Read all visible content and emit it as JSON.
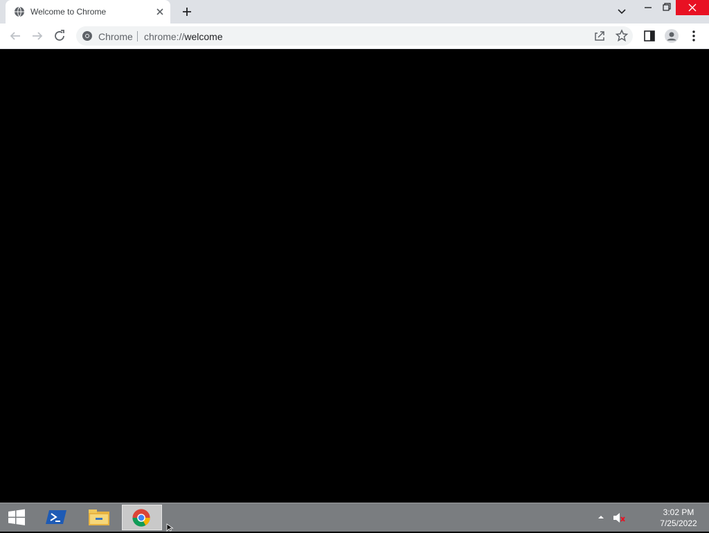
{
  "browser": {
    "tab": {
      "title": "Welcome to Chrome",
      "favicon": "globe-icon"
    },
    "window_controls": [
      "tab-search-icon",
      "minimize-icon",
      "restore-icon",
      "close-icon"
    ],
    "toolbar": {
      "buttons": [
        "back-arrow-icon",
        "forward-arrow-icon",
        "reload-icon"
      ],
      "omnibox": {
        "chip_label": "Chrome",
        "url_scheme": "chrome://",
        "url_host": "welcome"
      },
      "right_icons": [
        "share-icon",
        "bookmark-star-icon",
        "side-panel-icon",
        "profile-icon",
        "menu-kebab-icon"
      ]
    },
    "content": {
      "background": "#000000"
    }
  },
  "taskbar": {
    "apps": [
      "windows-start-icon",
      "powershell-icon",
      "file-explorer-icon",
      "chrome-icon"
    ],
    "tray": {
      "icons": [
        "tray-arrow-icon",
        "speaker-muted-icon"
      ]
    },
    "clock": {
      "time": "3:02 PM",
      "date": "7/25/2022"
    }
  },
  "colors": {
    "accent_close": "#e81123",
    "titlebar": "#dee1e6",
    "taskbar": "#7a7d80"
  }
}
